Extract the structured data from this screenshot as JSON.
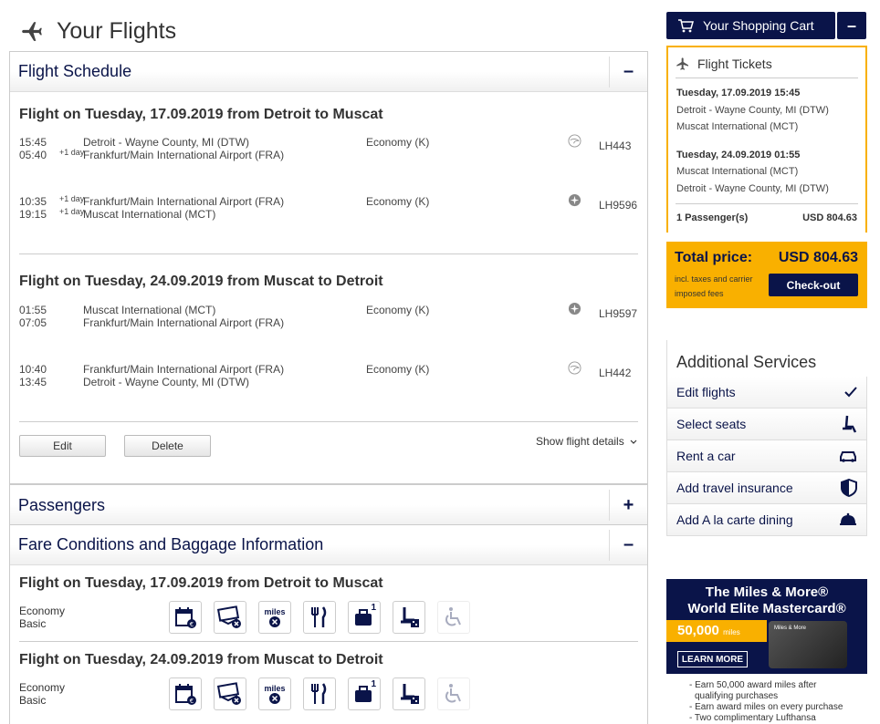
{
  "page": {
    "title": "Your Flights"
  },
  "schedule": {
    "title": "Flight Schedule",
    "toggle": "–",
    "outbound": {
      "title": "Flight on Tuesday, 17.09.2019 from Detroit to Muscat",
      "segments": [
        {
          "dep_time": "15:45",
          "dep_day": "",
          "dep_airport": "Detroit - Wayne County, MI (DTW)",
          "arr_time": "05:40",
          "arr_day": "+1 day",
          "arr_airport": "Frankfurt/Main International Airport (FRA)",
          "cabin": "Economy (K)",
          "flight": "LH443",
          "icon": "lufthansa-crane-icon"
        },
        {
          "dep_time": "10:35",
          "dep_day": "+1 day",
          "dep_airport": "Frankfurt/Main International Airport (FRA)",
          "arr_time": "19:15",
          "arr_day": "+1 day",
          "arr_airport": "Muscat International (MCT)",
          "cabin": "Economy (K)",
          "flight": "LH9596",
          "icon": "partner-airline-icon"
        }
      ]
    },
    "inbound": {
      "title": "Flight on Tuesday, 24.09.2019 from Muscat to Detroit",
      "segments": [
        {
          "dep_time": "01:55",
          "dep_day": "",
          "dep_airport": "Muscat International (MCT)",
          "arr_time": "07:05",
          "arr_day": "",
          "arr_airport": "Frankfurt/Main International Airport (FRA)",
          "cabin": "Economy (K)",
          "flight": "LH9597",
          "icon": "partner-airline-icon"
        },
        {
          "dep_time": "10:40",
          "dep_day": "",
          "dep_airport": "Frankfurt/Main International Airport (FRA)",
          "arr_time": "13:45",
          "arr_day": "",
          "arr_airport": "Detroit - Wayne County, MI (DTW)",
          "cabin": "Economy (K)",
          "flight": "LH442",
          "icon": "lufthansa-crane-icon"
        }
      ]
    },
    "edit_label": "Edit",
    "delete_label": "Delete",
    "details_label": "Show flight details"
  },
  "passengers": {
    "title": "Passengers",
    "toggle": "+"
  },
  "fare": {
    "title": "Fare Conditions and Baggage Information",
    "toggle": "–",
    "rows": [
      {
        "title": "Flight on Tuesday, 17.09.2019 from Detroit to Muscat",
        "fare_line1": "Economy",
        "fare_line2": "Basic"
      },
      {
        "title": "Flight on Tuesday, 24.09.2019 from Muscat to Detroit",
        "fare_line1": "Economy",
        "fare_line2": "Basic"
      }
    ],
    "icons": [
      "rebooking-fee-icon",
      "refund-fee-icon",
      "miles-icon",
      "meal-icon",
      "baggage-icon",
      "seat-reservation-icon",
      "special-assistance-icon"
    ],
    "miles_text": "miles",
    "baggage_count": "1"
  },
  "cart": {
    "button_label": "Your Shopping Cart",
    "minus": "–",
    "tickets_label": "Flight Tickets",
    "out_date": "Tuesday, 17.09.2019 15:45",
    "out_from": "Detroit - Wayne County, MI (DTW)",
    "out_to": "Muscat International (MCT)",
    "in_date": "Tuesday, 24.09.2019 01:55",
    "in_from": "Muscat International (MCT)",
    "in_to": "Detroit - Wayne County, MI (DTW)",
    "passengers": "1 Passenger(s)",
    "subtotal": "USD 804.63"
  },
  "total": {
    "label": "Total price:",
    "amount": "USD 804.63",
    "note_line1": "incl. taxes and carrier",
    "note_line2": "imposed fees",
    "checkout_label": "Check-out"
  },
  "services": {
    "title": "Additional Services",
    "items": [
      {
        "label": "Edit flights",
        "icon": "checkmark-icon"
      },
      {
        "label": "Select seats",
        "icon": "seat-icon"
      },
      {
        "label": "Rent a car",
        "icon": "car-icon"
      },
      {
        "label": "Add travel insurance",
        "icon": "shield-icon"
      },
      {
        "label": "Add A la carte dining",
        "icon": "dining-cloche-icon"
      }
    ]
  },
  "ad": {
    "headline1": "The Miles & More®",
    "headline2": "World Elite Mastercard®",
    "miles_amount": "50,000",
    "miles_unit": "miles",
    "learn_more": "LEARN MORE",
    "card_brand": "Miles & More",
    "bullets": [
      "- Earn 50,000 award miles after",
      "  qualifying purchases",
      "- Earn award miles on every purchase",
      "- Two complimentary Lufthansa"
    ]
  },
  "colors": {
    "brand_navy": "#0a1449",
    "accent_yellow": "#f9b000"
  }
}
